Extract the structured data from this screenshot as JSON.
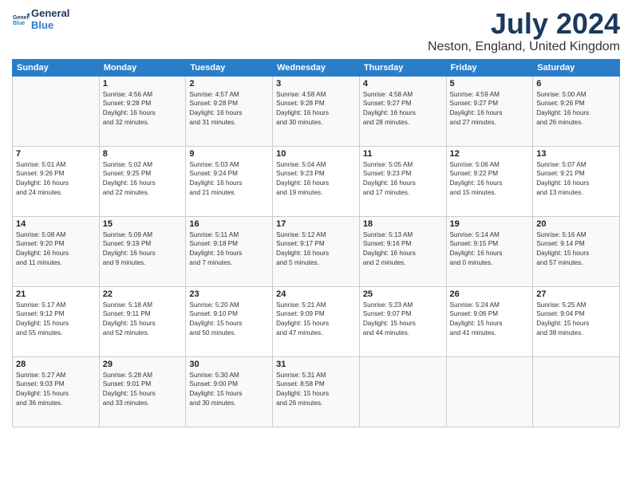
{
  "header": {
    "logo_line1": "General",
    "logo_line2": "Blue",
    "month_year": "July 2024",
    "location": "Neston, England, United Kingdom"
  },
  "days_of_week": [
    "Sunday",
    "Monday",
    "Tuesday",
    "Wednesday",
    "Thursday",
    "Friday",
    "Saturday"
  ],
  "weeks": [
    [
      {
        "day": "",
        "info": ""
      },
      {
        "day": "1",
        "info": "Sunrise: 4:56 AM\nSunset: 9:28 PM\nDaylight: 16 hours\nand 32 minutes."
      },
      {
        "day": "2",
        "info": "Sunrise: 4:57 AM\nSunset: 9:28 PM\nDaylight: 16 hours\nand 31 minutes."
      },
      {
        "day": "3",
        "info": "Sunrise: 4:58 AM\nSunset: 9:28 PM\nDaylight: 16 hours\nand 30 minutes."
      },
      {
        "day": "4",
        "info": "Sunrise: 4:58 AM\nSunset: 9:27 PM\nDaylight: 16 hours\nand 28 minutes."
      },
      {
        "day": "5",
        "info": "Sunrise: 4:59 AM\nSunset: 9:27 PM\nDaylight: 16 hours\nand 27 minutes."
      },
      {
        "day": "6",
        "info": "Sunrise: 5:00 AM\nSunset: 9:26 PM\nDaylight: 16 hours\nand 26 minutes."
      }
    ],
    [
      {
        "day": "7",
        "info": "Sunrise: 5:01 AM\nSunset: 9:26 PM\nDaylight: 16 hours\nand 24 minutes."
      },
      {
        "day": "8",
        "info": "Sunrise: 5:02 AM\nSunset: 9:25 PM\nDaylight: 16 hours\nand 22 minutes."
      },
      {
        "day": "9",
        "info": "Sunrise: 5:03 AM\nSunset: 9:24 PM\nDaylight: 16 hours\nand 21 minutes."
      },
      {
        "day": "10",
        "info": "Sunrise: 5:04 AM\nSunset: 9:23 PM\nDaylight: 16 hours\nand 19 minutes."
      },
      {
        "day": "11",
        "info": "Sunrise: 5:05 AM\nSunset: 9:23 PM\nDaylight: 16 hours\nand 17 minutes."
      },
      {
        "day": "12",
        "info": "Sunrise: 5:06 AM\nSunset: 9:22 PM\nDaylight: 16 hours\nand 15 minutes."
      },
      {
        "day": "13",
        "info": "Sunrise: 5:07 AM\nSunset: 9:21 PM\nDaylight: 16 hours\nand 13 minutes."
      }
    ],
    [
      {
        "day": "14",
        "info": "Sunrise: 5:08 AM\nSunset: 9:20 PM\nDaylight: 16 hours\nand 11 minutes."
      },
      {
        "day": "15",
        "info": "Sunrise: 5:09 AM\nSunset: 9:19 PM\nDaylight: 16 hours\nand 9 minutes."
      },
      {
        "day": "16",
        "info": "Sunrise: 5:11 AM\nSunset: 9:18 PM\nDaylight: 16 hours\nand 7 minutes."
      },
      {
        "day": "17",
        "info": "Sunrise: 5:12 AM\nSunset: 9:17 PM\nDaylight: 16 hours\nand 5 minutes."
      },
      {
        "day": "18",
        "info": "Sunrise: 5:13 AM\nSunset: 9:16 PM\nDaylight: 16 hours\nand 2 minutes."
      },
      {
        "day": "19",
        "info": "Sunrise: 5:14 AM\nSunset: 9:15 PM\nDaylight: 16 hours\nand 0 minutes."
      },
      {
        "day": "20",
        "info": "Sunrise: 5:16 AM\nSunset: 9:14 PM\nDaylight: 15 hours\nand 57 minutes."
      }
    ],
    [
      {
        "day": "21",
        "info": "Sunrise: 5:17 AM\nSunset: 9:12 PM\nDaylight: 15 hours\nand 55 minutes."
      },
      {
        "day": "22",
        "info": "Sunrise: 5:18 AM\nSunset: 9:11 PM\nDaylight: 15 hours\nand 52 minutes."
      },
      {
        "day": "23",
        "info": "Sunrise: 5:20 AM\nSunset: 9:10 PM\nDaylight: 15 hours\nand 50 minutes."
      },
      {
        "day": "24",
        "info": "Sunrise: 5:21 AM\nSunset: 9:09 PM\nDaylight: 15 hours\nand 47 minutes."
      },
      {
        "day": "25",
        "info": "Sunrise: 5:23 AM\nSunset: 9:07 PM\nDaylight: 15 hours\nand 44 minutes."
      },
      {
        "day": "26",
        "info": "Sunrise: 5:24 AM\nSunset: 9:06 PM\nDaylight: 15 hours\nand 41 minutes."
      },
      {
        "day": "27",
        "info": "Sunrise: 5:25 AM\nSunset: 9:04 PM\nDaylight: 15 hours\nand 38 minutes."
      }
    ],
    [
      {
        "day": "28",
        "info": "Sunrise: 5:27 AM\nSunset: 9:03 PM\nDaylight: 15 hours\nand 36 minutes."
      },
      {
        "day": "29",
        "info": "Sunrise: 5:28 AM\nSunset: 9:01 PM\nDaylight: 15 hours\nand 33 minutes."
      },
      {
        "day": "30",
        "info": "Sunrise: 5:30 AM\nSunset: 9:00 PM\nDaylight: 15 hours\nand 30 minutes."
      },
      {
        "day": "31",
        "info": "Sunrise: 5:31 AM\nSunset: 8:58 PM\nDaylight: 15 hours\nand 26 minutes."
      },
      {
        "day": "",
        "info": ""
      },
      {
        "day": "",
        "info": ""
      },
      {
        "day": "",
        "info": ""
      }
    ]
  ]
}
